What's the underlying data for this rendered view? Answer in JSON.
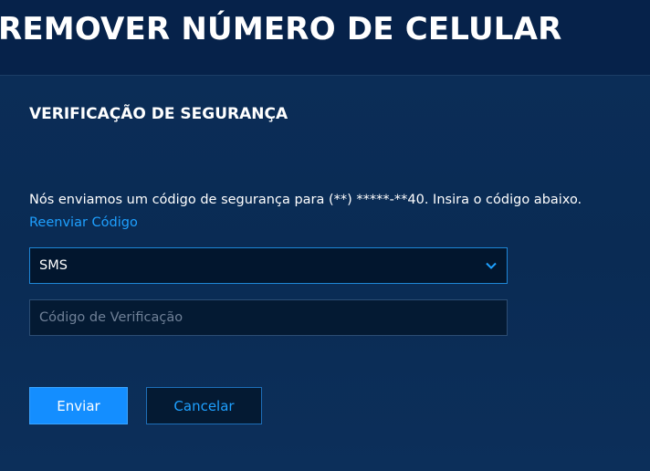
{
  "header": {
    "title": "REMOVER NÚMERO DE CELULAR"
  },
  "panel": {
    "section_title": "VERIFICAÇÃO DE SEGURANÇA",
    "message": "Nós enviamos um código de segurança para (**) *****-**40. Insira o código abaixo.",
    "resend_link": "Reenviar Código",
    "method_select": {
      "selected": "SMS",
      "icon": "chevron-down-icon"
    },
    "code_input": {
      "value": "",
      "placeholder": "Código de Verificação"
    },
    "buttons": {
      "send_label": "Enviar",
      "cancel_label": "Cancelar"
    }
  },
  "colors": {
    "background": "#06224a",
    "accent": "#148eff",
    "link": "#1ea0ff",
    "field_background": "#02162e"
  }
}
